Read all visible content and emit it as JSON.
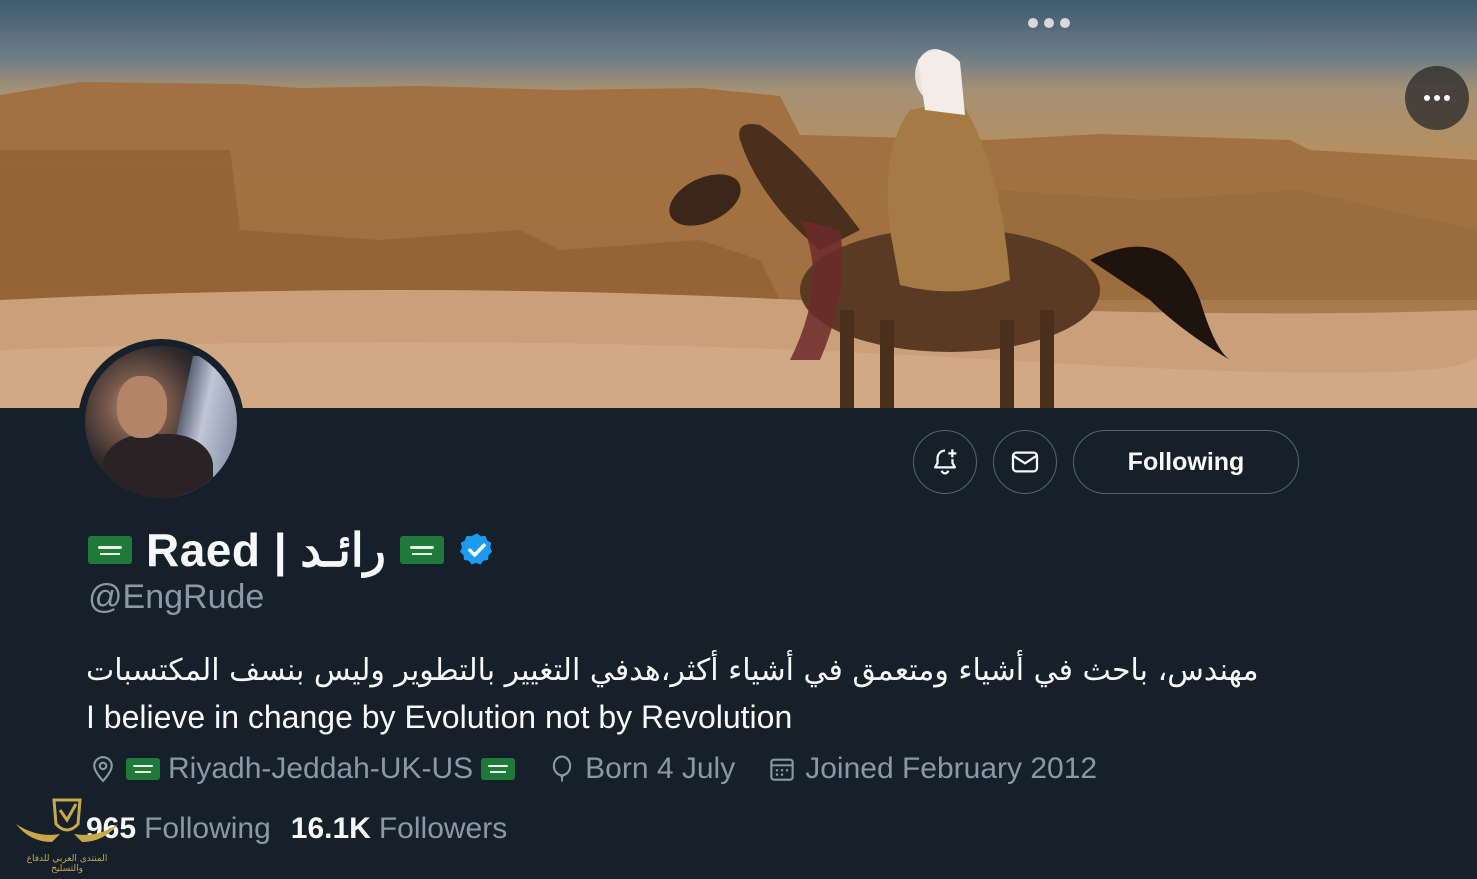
{
  "banner": {
    "description_icon": "desert-horse-rider-banner"
  },
  "top_actions": {
    "more_icon": "more-horizontal-icon"
  },
  "profile_actions": {
    "notify_icon": "bell-plus-icon",
    "message_icon": "mail-icon",
    "follow_label": "Following"
  },
  "profile": {
    "display_name": "Raed | رائـد",
    "handle": "@EngRude",
    "verified_color": "#1d9bf0",
    "bio_arabic": "مهندس، باحث في أشياء ومتعمق في أشياء أكثر،هدفي التغيير بالتطوير وليس بنسف المكتسبات",
    "bio_english": "I believe in change by Evolution not by Revolution",
    "location": "Riyadh-Jeddah-UK-US",
    "birthday": "Born 4 July",
    "joined": "Joined February 2012",
    "following_count": "965",
    "following_label": "Following",
    "followers_count": "16.1K",
    "followers_label": "Followers"
  },
  "watermark": {
    "text": "المنتدى العربي للدفاع والتسليح"
  },
  "colors": {
    "background": "#15202b",
    "primary_text": "#f7f9f9",
    "secondary_text": "#8b98a5",
    "border": "#536471",
    "flag_green": "#1f7a3a"
  }
}
